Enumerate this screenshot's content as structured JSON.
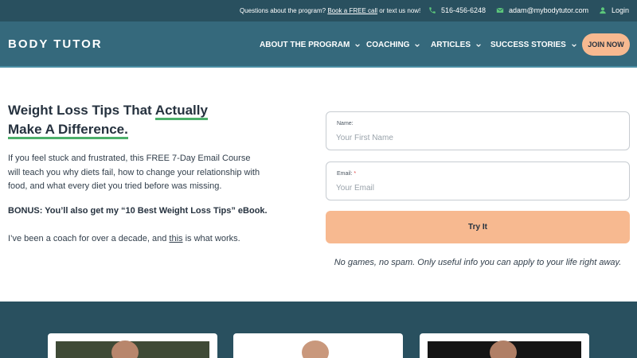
{
  "topbar": {
    "question_prefix": "Questions about the program?",
    "book_link": "Book a FREE call",
    "question_suffix": "or text us now!",
    "phone": "516-456-6248",
    "email": "adam@mybodytutor.com",
    "login": "Login"
  },
  "nav": {
    "logo": "BODY TUTOR",
    "items": [
      {
        "label": "ABOUT THE PROGRAM"
      },
      {
        "label": "COACHING"
      },
      {
        "label": "ARTICLES"
      },
      {
        "label": "SUCCESS STORIES"
      }
    ],
    "cta": "JOIN NOW"
  },
  "hero": {
    "headline_part1": "Weight Loss Tips That",
    "headline_highlight1": "Actually",
    "headline_highlight2": "Make A Difference.",
    "intro": "If you feel stuck and frustrated, this FREE 7-Day Email Course will teach you why diets fail, how to change your relationship with food, and what every diet you tried before was missing.",
    "bonus": "BONUS: You’ll also get my “10 Best Weight Loss Tips” eBook.",
    "coach_prefix": "I’ve been a coach for over a decade, and",
    "coach_link": "this",
    "coach_suffix": "is what works."
  },
  "form": {
    "name_label": "Name:",
    "name_placeholder": "Your First Name",
    "email_label": "Email:",
    "email_required": "*",
    "email_placeholder": "Your Email",
    "submit": "Try It",
    "note": "No games, no spam. Only useful info you can apply to your life right away."
  },
  "colors": {
    "topbar_bg": "#29505f",
    "nav_bg": "#35697c",
    "accent_peach": "#f7b990",
    "underline_green": "#4caf6a"
  },
  "icons": {
    "phone": "phone-icon",
    "email": "envelope-icon",
    "login": "user-icon",
    "dropdown": "chevron-down-icon"
  }
}
